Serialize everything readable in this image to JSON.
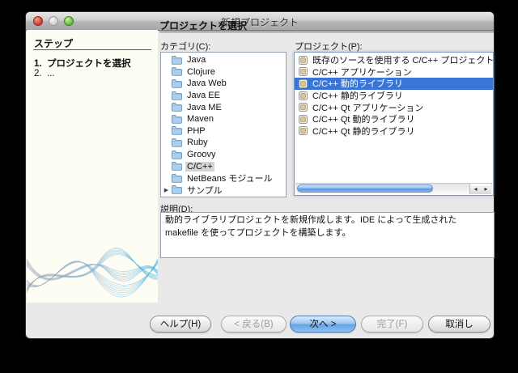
{
  "window": {
    "title": "新規プロジェクト",
    "lights": [
      "close",
      "minimize",
      "zoom"
    ]
  },
  "steps_panel": {
    "header": "ステップ",
    "items": [
      {
        "number": "1.",
        "label": "プロジェクトを選択"
      },
      {
        "number": "2.",
        "label": "..."
      }
    ]
  },
  "main": {
    "header": "プロジェクトを選択",
    "categories_label": "カテゴリ(C):",
    "projects_label": "プロジェクト(P):",
    "categories": [
      {
        "label": "Java",
        "selected": false,
        "expandable": false
      },
      {
        "label": "Clojure",
        "selected": false,
        "expandable": false
      },
      {
        "label": "Java Web",
        "selected": false,
        "expandable": false
      },
      {
        "label": "Java EE",
        "selected": false,
        "expandable": false
      },
      {
        "label": "Java ME",
        "selected": false,
        "expandable": false
      },
      {
        "label": "Maven",
        "selected": false,
        "expandable": false
      },
      {
        "label": "PHP",
        "selected": false,
        "expandable": false
      },
      {
        "label": "Ruby",
        "selected": false,
        "expandable": false
      },
      {
        "label": "Groovy",
        "selected": false,
        "expandable": false
      },
      {
        "label": "C/C++",
        "selected": true,
        "expandable": false
      },
      {
        "label": "NetBeans モジュール",
        "selected": false,
        "expandable": false
      },
      {
        "label": "サンプル",
        "selected": false,
        "expandable": true
      }
    ],
    "projects": [
      {
        "label": "既存のソースを使用する C/C++ プロジェクト",
        "selected": false
      },
      {
        "label": "C/C++ アプリケーション",
        "selected": false
      },
      {
        "label": "C/C++ 動的ライブラリ",
        "selected": true
      },
      {
        "label": "C/C++ 静的ライブラリ",
        "selected": false
      },
      {
        "label": "C/C++ Qt アプリケーション",
        "selected": false
      },
      {
        "label": "C/C++ Qt 動的ライブラリ",
        "selected": false
      },
      {
        "label": "C/C++ Qt 静的ライブラリ",
        "selected": false
      }
    ],
    "description_label": "説明(D):",
    "description_text": "動的ライブラリプロジェクトを新規作成します。IDE によって生成された makefile を使ってプロジェクトを構築します。"
  },
  "scrollbar": {
    "left_arrow": "◂",
    "right_arrow": "▸"
  },
  "buttons": {
    "help": "ヘルプ(H)",
    "back": "< 戻る(B)",
    "next": "次へ >",
    "finish": "完了(F)",
    "cancel": "取消し"
  },
  "colors": {
    "selection_blue": "#3875d7",
    "category_selection_gray": "#d4d4d4",
    "left_panel_cream": "#fdfdf3",
    "dialog_gray": "#e9e9e9"
  }
}
